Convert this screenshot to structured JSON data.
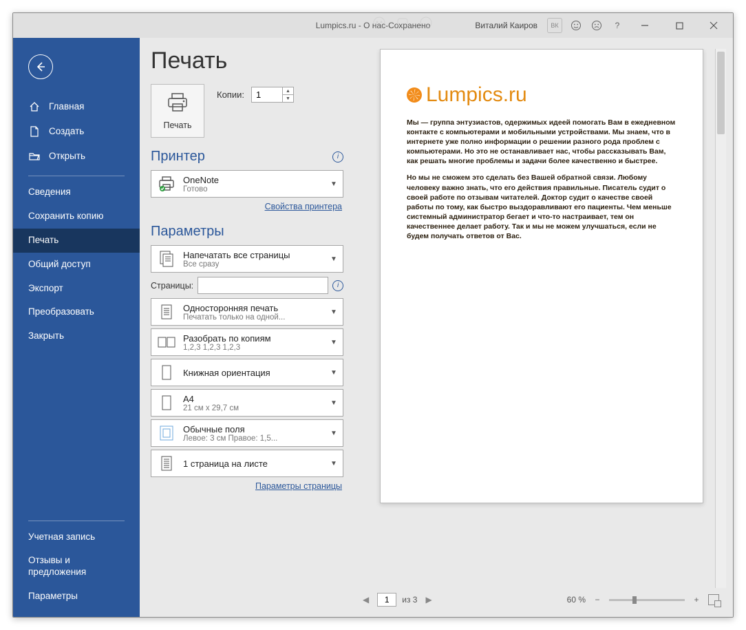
{
  "titlebar": {
    "doc": "Lumpics.ru - О нас",
    "sep": "  -  ",
    "status": "Сохранено",
    "user": "Виталий Каиров",
    "initials": "ВК"
  },
  "sidebar": {
    "home": "Главная",
    "new": "Создать",
    "open": "Открыть",
    "info": "Сведения",
    "savecopy": "Сохранить копию",
    "print": "Печать",
    "share": "Общий доступ",
    "export": "Экспорт",
    "transform": "Преобразовать",
    "close": "Закрыть",
    "account": "Учетная запись",
    "feedback": "Отзывы и предложения",
    "options": "Параметры"
  },
  "page": {
    "title": "Печать",
    "print_btn": "Печать",
    "copies_label": "Копии:",
    "copies_value": "1",
    "printer_heading": "Принтер",
    "printer": {
      "name": "OneNote",
      "status": "Готово"
    },
    "printer_props": "Свойства принтера",
    "params_heading": "Параметры",
    "opt_pages": {
      "t1": "Напечатать все страницы",
      "t2": "Все сразу"
    },
    "pages_label": "Страницы:",
    "opt_sides": {
      "t1": "Односторонняя печать",
      "t2": "Печатать только на одной..."
    },
    "opt_collate": {
      "t1": "Разобрать по копиям",
      "t2": "1,2,3    1,2,3    1,2,3"
    },
    "opt_orient": {
      "t1": "Книжная ориентация",
      "t2": ""
    },
    "opt_paper": {
      "t1": "A4",
      "t2": "21 см x 29,7 см"
    },
    "opt_margins": {
      "t1": "Обычные поля",
      "t2": "Левое:  3 см    Правое:  1,5..."
    },
    "opt_perpage": {
      "t1": "1 страница на листе",
      "t2": ""
    },
    "page_setup": "Параметры страницы"
  },
  "preview": {
    "heading": "Lumpics.ru",
    "p1": "Мы — группа энтузиастов, одержимых идеей помогать Вам в ежедневном контакте с компьютерами и мобильными устройствами. Мы знаем, что в интернете уже полно информации о решении разного рода проблем с компьютерами. Но это не останавливает нас, чтобы рассказывать Вам, как решать многие проблемы и задачи более качественно и быстрее.",
    "p2": "Но мы не сможем это сделать без Вашей обратной связи. Любому человеку важно знать, что его действия правильные. Писатель судит о своей работе по отзывам читателей. Доктор судит о качестве своей работы по тому, как быстро выздоравливают его пациенты. Чем меньше системный администратор бегает и что-то настраивает, тем он качественнее делает работу. Так и мы не можем улучшаться, если не будем получать ответов от Вас."
  },
  "footer": {
    "page_current": "1",
    "page_of": "из 3",
    "zoom": "60 %"
  }
}
